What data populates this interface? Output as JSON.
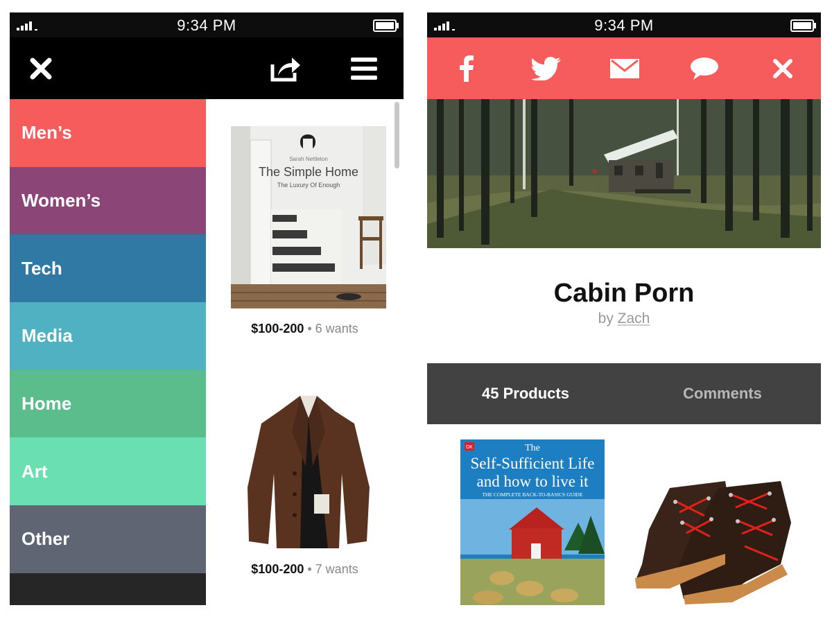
{
  "status_bar": {
    "time": "9:34 PM"
  },
  "left_screen": {
    "nav": {
      "close_icon": "close-icon",
      "share_icon": "share-icon",
      "menu_icon": "menu-icon"
    },
    "categories": [
      {
        "label": "Men’s",
        "color": "#f65c5b"
      },
      {
        "label": "Women’s",
        "color": "#8b4577"
      },
      {
        "label": "Tech",
        "color": "#2f79a4"
      },
      {
        "label": "Media",
        "color": "#4fb1c2"
      },
      {
        "label": "Home",
        "color": "#5bbd8c"
      },
      {
        "label": "Art",
        "color": "#6ae0b2"
      },
      {
        "label": "Other",
        "color": "#5f6573"
      }
    ],
    "products": [
      {
        "price": "$100-200",
        "separator": " • ",
        "wants": "6 wants",
        "book": {
          "author": "Sarah Nettleton",
          "title": "The Simple Home",
          "subtitle": "The Luxury Of Enough"
        }
      },
      {
        "price": "$100-200",
        "separator": " • ",
        "wants": "7 wants"
      }
    ]
  },
  "right_screen": {
    "share_icons": [
      "facebook-icon",
      "twitter-icon",
      "email-icon",
      "message-icon",
      "close-icon"
    ],
    "collection": {
      "title": "Cabin Porn",
      "by_prefix": "by ",
      "author": "Zach"
    },
    "tabs": [
      {
        "label": "45 Products",
        "active": true
      },
      {
        "label": "Comments",
        "active": false
      }
    ],
    "grid_products": [
      {
        "book": {
          "publisher": "DK",
          "title_line1": "The",
          "title_line2": "Self-Sufficient Life",
          "title_line3": "and how to live it",
          "subtitle": "THE COMPLETE BACK-TO-BASICS GUIDE"
        }
      },
      {
        "item": "boots"
      }
    ]
  },
  "colors": {
    "accent": "#f65c5b",
    "tab_bar": "#424242",
    "nav_bar": "#000000"
  }
}
